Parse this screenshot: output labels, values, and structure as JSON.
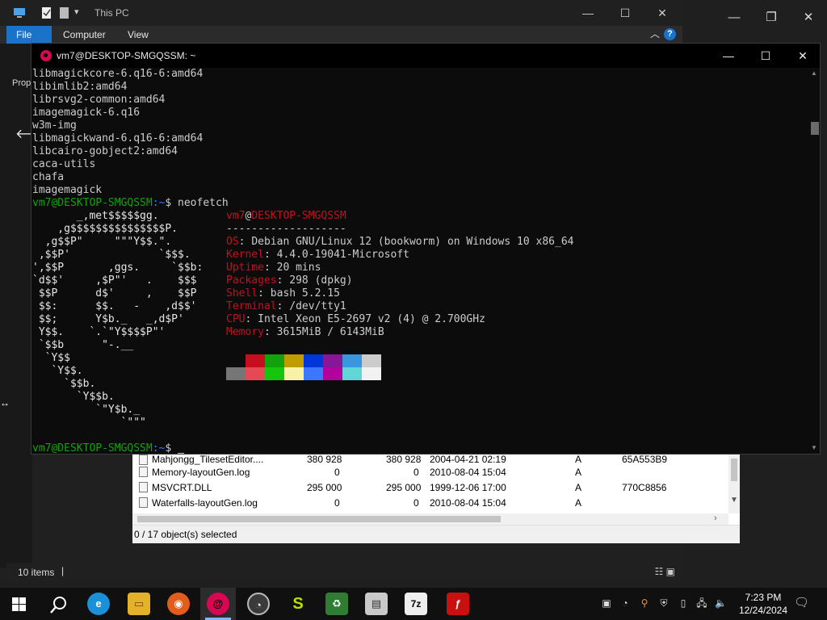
{
  "explorer": {
    "title": "This PC",
    "tabs": [
      "File",
      "Computer",
      "View"
    ],
    "help": "?",
    "left_partial": "Prop",
    "files": [
      {
        "name": "Mahjongg_TilesetEditor....",
        "size": "380 928",
        "packed": "380 928",
        "modified": "2004-04-21 02:19",
        "attr": "A",
        "crc": "65A553B9"
      },
      {
        "name": "Memory-layoutGen.log",
        "size": "0",
        "packed": "0",
        "modified": "2010-08-04 15:04",
        "attr": "A",
        "crc": ""
      },
      {
        "name": "MSVCRT.DLL",
        "size": "295 000",
        "packed": "295 000",
        "modified": "1999-12-06 17:00",
        "attr": "A",
        "crc": "770C8856"
      },
      {
        "name": "Waterfalls-layoutGen.log",
        "size": "0",
        "packed": "0",
        "modified": "2010-08-04 15:04",
        "attr": "A",
        "crc": ""
      }
    ],
    "selection_status": "0 / 17 object(s) selected",
    "items_count": "10 items"
  },
  "terminal": {
    "title": "vm7@DESKTOP-SMGQSSM: ~",
    "output_lines": [
      "libmagickcore-6.q16-6:amd64",
      "libimlib2:amd64",
      "librsvg2-common:amd64",
      "imagemagick-6.q16",
      "w3m-img",
      "libmagickwand-6.q16-6:amd64",
      "libcairo-gobject2:amd64",
      "caca-utils",
      "chafa",
      "imagemagick"
    ],
    "prompt_user": "vm7@DESKTOP-SMGQSSM",
    "prompt_path": ":~",
    "prompt_symbol": "$ ",
    "command": "neofetch",
    "ascii_logo": [
      "       _,met$$$$$gg.",
      "    ,g$$$$$$$$$$$$$$$P.",
      "  ,g$$P\"     \"\"\"Y$$.\".",
      " ,$$P'              `$$$.",
      "',$$P       ,ggs.     `$$b:",
      "`d$$'     ,$P\"'   .    $$$",
      " $$P      d$'     ,    $$P",
      " $$:      $$.   -    ,d$$'",
      " $$;      Y$b._   _,d$P'",
      " Y$$.    `.`\"Y$$$$P\"'",
      " `$$b      \"-.__",
      "  `Y$$",
      "   `Y$$.",
      "     `$$b.",
      "       `Y$$b.",
      "          `\"Y$b._",
      "              `\"\"\""
    ],
    "neofetch_header_user": "vm7",
    "neofetch_header_at": "@",
    "neofetch_header_host": "DESKTOP-SMGQSSM",
    "separator": "-------------------",
    "info": [
      {
        "key": "OS",
        "value": "Debian GNU/Linux 12 (bookworm) on Windows 10 x86_64"
      },
      {
        "key": "Kernel",
        "value": "4.4.0-19041-Microsoft"
      },
      {
        "key": "Uptime",
        "value": "20 mins"
      },
      {
        "key": "Packages",
        "value": "298 (dpkg)"
      },
      {
        "key": "Shell",
        "value": "bash 5.2.15"
      },
      {
        "key": "Terminal",
        "value": "/dev/tty1"
      },
      {
        "key": "CPU",
        "value": "Intel Xeon E5-2697 v2 (4) @ 2.700GHz"
      },
      {
        "key": "Memory",
        "value": "3615MiB / 6143MiB"
      }
    ],
    "palette_top": [
      "#0c0c0c",
      "#c50f1f",
      "#13a10e",
      "#c19c00",
      "#0037da",
      "#881798",
      "#3a96dd",
      "#cccccc"
    ],
    "palette_bottom": [
      "#767676",
      "#e74856",
      "#16c60c",
      "#f9f1a5",
      "#3b78ff",
      "#b4009e",
      "#61d6d6",
      "#f2f2f2"
    ]
  },
  "taskbar": {
    "time": "7:23 PM",
    "date": "12/24/2024",
    "seven_zip": "7z"
  },
  "colors": {
    "accent": "#1a73c9",
    "debian": "#d70751"
  }
}
